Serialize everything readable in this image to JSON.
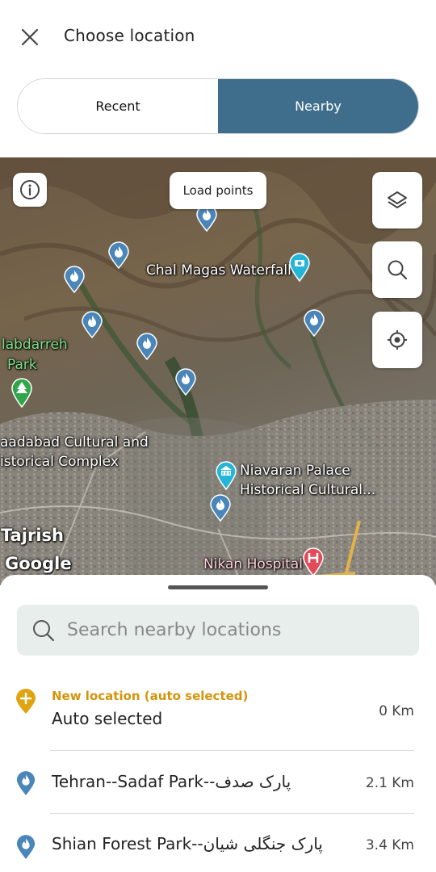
{
  "header": {
    "title": "Choose location"
  },
  "tabs": {
    "recent": "Recent",
    "nearby": "Nearby"
  },
  "map": {
    "load_points": "Load points",
    "labels": {
      "waterfall": "Chal Magas Waterfall",
      "park_line1": "labdarreh",
      "park_line2": "Park",
      "complex_line1": "aadabad Cultural and",
      "complex_line2": "istorical Complex",
      "palace_line1": "Niavaran Palace",
      "palace_line2": "Historical Cultural...",
      "tajrish": "Tajrish",
      "google": "Google",
      "hospital": "Nikan Hospital"
    },
    "colors": {
      "pin": "#4a86b9",
      "poi": "#25b5d8",
      "hospital": "#e04c5a",
      "park": "#2fa64a"
    }
  },
  "search": {
    "placeholder": "Search nearby locations"
  },
  "list": [
    {
      "subtitle": "New location (auto selected)",
      "title": "Auto selected",
      "distance": "0 Km",
      "icon": "plus-pin-icon",
      "color": "#e0a311"
    },
    {
      "title": "Tehran--Sadaf Park--پارک صدف",
      "distance": "2.1 Km",
      "icon": "fire-pin-icon"
    },
    {
      "title": "Shian Forest Park--پارک جنگلی شیان",
      "distance": "3.4 Km",
      "icon": "fire-pin-icon"
    }
  ]
}
